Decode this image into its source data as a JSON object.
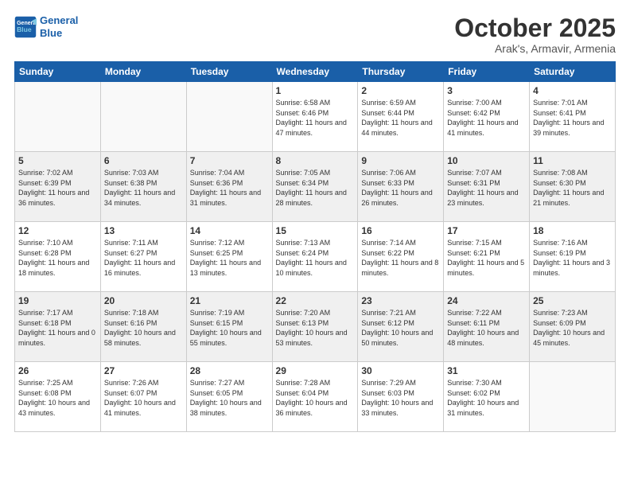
{
  "header": {
    "logo_line1": "General",
    "logo_line2": "Blue",
    "month_title": "October 2025",
    "subtitle": "Arak's, Armavir, Armenia"
  },
  "weekdays": [
    "Sunday",
    "Monday",
    "Tuesday",
    "Wednesday",
    "Thursday",
    "Friday",
    "Saturday"
  ],
  "weeks": [
    [
      {
        "day": "",
        "empty": true
      },
      {
        "day": "",
        "empty": true
      },
      {
        "day": "",
        "empty": true
      },
      {
        "day": "1",
        "sunrise": "6:58 AM",
        "sunset": "6:46 PM",
        "daylight": "11 hours and 47 minutes."
      },
      {
        "day": "2",
        "sunrise": "6:59 AM",
        "sunset": "6:44 PM",
        "daylight": "11 hours and 44 minutes."
      },
      {
        "day": "3",
        "sunrise": "7:00 AM",
        "sunset": "6:42 PM",
        "daylight": "11 hours and 41 minutes."
      },
      {
        "day": "4",
        "sunrise": "7:01 AM",
        "sunset": "6:41 PM",
        "daylight": "11 hours and 39 minutes."
      }
    ],
    [
      {
        "day": "5",
        "sunrise": "7:02 AM",
        "sunset": "6:39 PM",
        "daylight": "11 hours and 36 minutes."
      },
      {
        "day": "6",
        "sunrise": "7:03 AM",
        "sunset": "6:38 PM",
        "daylight": "11 hours and 34 minutes."
      },
      {
        "day": "7",
        "sunrise": "7:04 AM",
        "sunset": "6:36 PM",
        "daylight": "11 hours and 31 minutes."
      },
      {
        "day": "8",
        "sunrise": "7:05 AM",
        "sunset": "6:34 PM",
        "daylight": "11 hours and 28 minutes."
      },
      {
        "day": "9",
        "sunrise": "7:06 AM",
        "sunset": "6:33 PM",
        "daylight": "11 hours and 26 minutes."
      },
      {
        "day": "10",
        "sunrise": "7:07 AM",
        "sunset": "6:31 PM",
        "daylight": "11 hours and 23 minutes."
      },
      {
        "day": "11",
        "sunrise": "7:08 AM",
        "sunset": "6:30 PM",
        "daylight": "11 hours and 21 minutes."
      }
    ],
    [
      {
        "day": "12",
        "sunrise": "7:10 AM",
        "sunset": "6:28 PM",
        "daylight": "11 hours and 18 minutes."
      },
      {
        "day": "13",
        "sunrise": "7:11 AM",
        "sunset": "6:27 PM",
        "daylight": "11 hours and 16 minutes."
      },
      {
        "day": "14",
        "sunrise": "7:12 AM",
        "sunset": "6:25 PM",
        "daylight": "11 hours and 13 minutes."
      },
      {
        "day": "15",
        "sunrise": "7:13 AM",
        "sunset": "6:24 PM",
        "daylight": "11 hours and 10 minutes."
      },
      {
        "day": "16",
        "sunrise": "7:14 AM",
        "sunset": "6:22 PM",
        "daylight": "11 hours and 8 minutes."
      },
      {
        "day": "17",
        "sunrise": "7:15 AM",
        "sunset": "6:21 PM",
        "daylight": "11 hours and 5 minutes."
      },
      {
        "day": "18",
        "sunrise": "7:16 AM",
        "sunset": "6:19 PM",
        "daylight": "11 hours and 3 minutes."
      }
    ],
    [
      {
        "day": "19",
        "sunrise": "7:17 AM",
        "sunset": "6:18 PM",
        "daylight": "11 hours and 0 minutes."
      },
      {
        "day": "20",
        "sunrise": "7:18 AM",
        "sunset": "6:16 PM",
        "daylight": "10 hours and 58 minutes."
      },
      {
        "day": "21",
        "sunrise": "7:19 AM",
        "sunset": "6:15 PM",
        "daylight": "10 hours and 55 minutes."
      },
      {
        "day": "22",
        "sunrise": "7:20 AM",
        "sunset": "6:13 PM",
        "daylight": "10 hours and 53 minutes."
      },
      {
        "day": "23",
        "sunrise": "7:21 AM",
        "sunset": "6:12 PM",
        "daylight": "10 hours and 50 minutes."
      },
      {
        "day": "24",
        "sunrise": "7:22 AM",
        "sunset": "6:11 PM",
        "daylight": "10 hours and 48 minutes."
      },
      {
        "day": "25",
        "sunrise": "7:23 AM",
        "sunset": "6:09 PM",
        "daylight": "10 hours and 45 minutes."
      }
    ],
    [
      {
        "day": "26",
        "sunrise": "7:25 AM",
        "sunset": "6:08 PM",
        "daylight": "10 hours and 43 minutes."
      },
      {
        "day": "27",
        "sunrise": "7:26 AM",
        "sunset": "6:07 PM",
        "daylight": "10 hours and 41 minutes."
      },
      {
        "day": "28",
        "sunrise": "7:27 AM",
        "sunset": "6:05 PM",
        "daylight": "10 hours and 38 minutes."
      },
      {
        "day": "29",
        "sunrise": "7:28 AM",
        "sunset": "6:04 PM",
        "daylight": "10 hours and 36 minutes."
      },
      {
        "day": "30",
        "sunrise": "7:29 AM",
        "sunset": "6:03 PM",
        "daylight": "10 hours and 33 minutes."
      },
      {
        "day": "31",
        "sunrise": "7:30 AM",
        "sunset": "6:02 PM",
        "daylight": "10 hours and 31 minutes."
      },
      {
        "day": "",
        "empty": true
      }
    ]
  ]
}
